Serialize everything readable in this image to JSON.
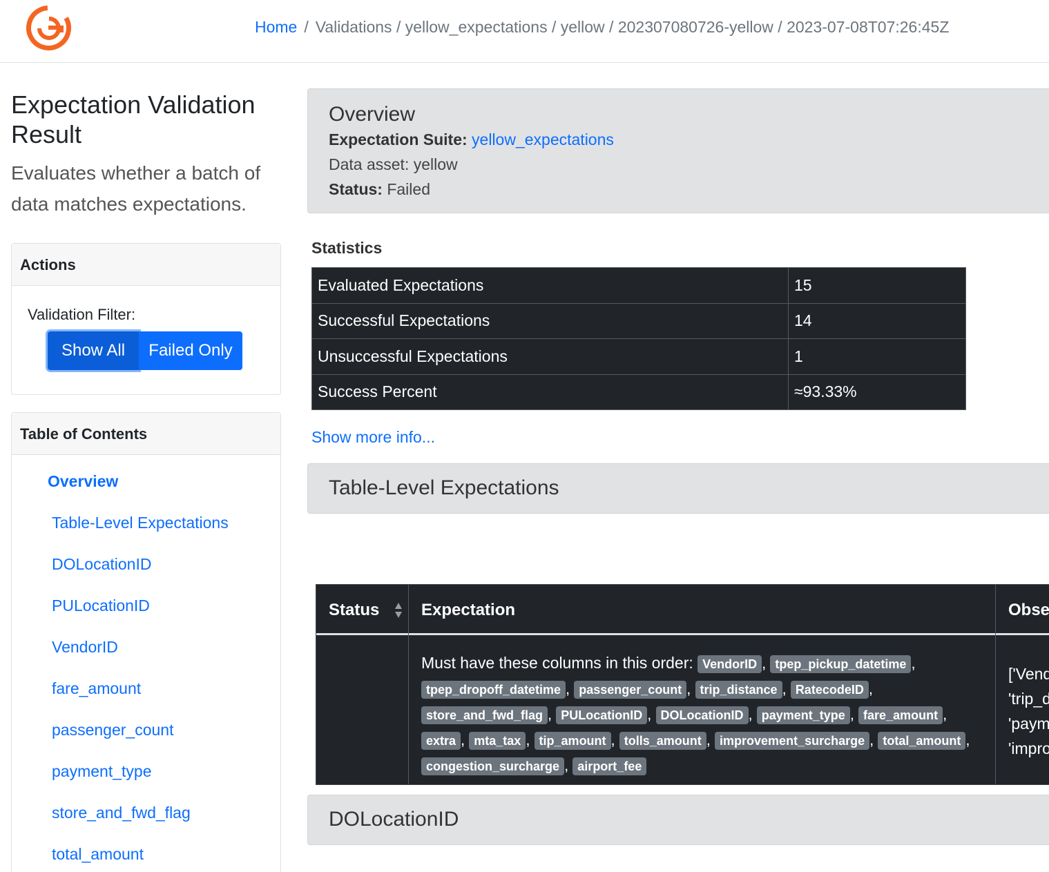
{
  "breadcrumb": {
    "home": "Home",
    "path": [
      "Validations",
      "yellow_expectations",
      "yellow",
      "202307080726-yellow",
      "2023-07-08T07:26:45Z"
    ]
  },
  "sidebar": {
    "title": "Expectation Validation Result",
    "lead": "Evaluates whether a batch of data matches expectations.",
    "actions": {
      "header": "Actions",
      "filter_label": "Validation Filter:",
      "show_all": "Show All",
      "failed_only": "Failed Only"
    },
    "toc": {
      "header": "Table of Contents",
      "items": [
        "Overview",
        "Table-Level Expectations",
        "DOLocationID",
        "PULocationID",
        "VendorID",
        "fare_amount",
        "passenger_count",
        "payment_type",
        "store_and_fwd_flag",
        "total_amount"
      ]
    }
  },
  "overview": {
    "title": "Overview",
    "suite_label": "Expectation Suite:",
    "suite_value": "yellow_expectations",
    "asset_label": "Data asset:",
    "asset_value": "yellow",
    "status_label": "Status:",
    "status_value": "Failed"
  },
  "statistics": {
    "title": "Statistics",
    "rows": [
      {
        "label": "Evaluated Expectations",
        "value": "15"
      },
      {
        "label": "Successful Expectations",
        "value": "14"
      },
      {
        "label": "Unsuccessful Expectations",
        "value": "1"
      },
      {
        "label": "Success Percent",
        "value": "≈93.33%"
      }
    ],
    "show_more": "Show more info..."
  },
  "sections": {
    "table_level": "Table-Level Expectations",
    "dolocation": "DOLocationID"
  },
  "expectation_table": {
    "headers": {
      "status": "Status",
      "expectation": "Expectation",
      "observed": "Observed Value"
    },
    "row": {
      "intro": "Must have these columns in this order:",
      "columns": [
        "VendorID",
        "tpep_pickup_datetime",
        "tpep_dropoff_datetime",
        "passenger_count",
        "trip_distance",
        "RatecodeID",
        "store_and_fwd_flag",
        "PULocationID",
        "DOLocationID",
        "payment_type",
        "fare_amount",
        "extra",
        "mta_tax",
        "tip_amount",
        "tolls_amount",
        "improvement_surcharge",
        "total_amount",
        "congestion_surcharge",
        "airport_fee"
      ],
      "observed_lines": [
        "['VendorID',",
        "'trip_distance',",
        "'payment_type',",
        "'improvement_surcharge',"
      ]
    }
  },
  "colors": {
    "link": "#0d6efd",
    "dark": "#212529",
    "badge": "#6c757d",
    "logo": "#f46522"
  }
}
